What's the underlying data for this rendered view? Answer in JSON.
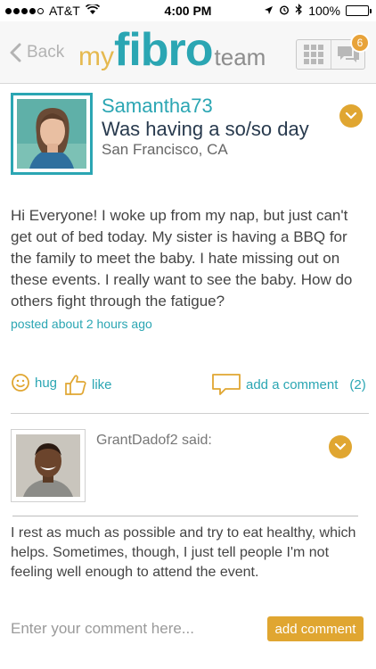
{
  "status_bar": {
    "carrier": "AT&T",
    "time": "4:00 PM",
    "battery": "100%",
    "battery_level": 1.0
  },
  "nav": {
    "back_label": "Back",
    "logo": {
      "my": "my",
      "fibro": "fibro",
      "team": "team"
    },
    "notification_count": "6"
  },
  "post": {
    "username": "Samantha73",
    "headline": "Was having a so/so day",
    "location": "San Francisco, CA",
    "body": "Hi Everyone! I woke up from my nap, but just can't get out of bed today. My sister is having a BBQ for the family to meet the baby. I hate missing out on these events. I really want to see the baby. How do others fight through the fatigue?",
    "posted": "posted about 2 hours ago"
  },
  "actions": {
    "hug": "hug",
    "like": "like",
    "add_comment": "add a comment",
    "comment_count": "(2)"
  },
  "reply": {
    "author_said": "GrantDadof2 said:",
    "body": "I rest as much as possible and try to eat healthy, which helps. Sometimes, though, I just tell people I'm not feeling well enough to attend the event."
  },
  "composer": {
    "placeholder": "Enter your comment here...",
    "button": "add comment"
  },
  "colors": {
    "teal": "#2ba6b3",
    "gold": "#e0a631",
    "logo_my": "#e5b94f"
  }
}
